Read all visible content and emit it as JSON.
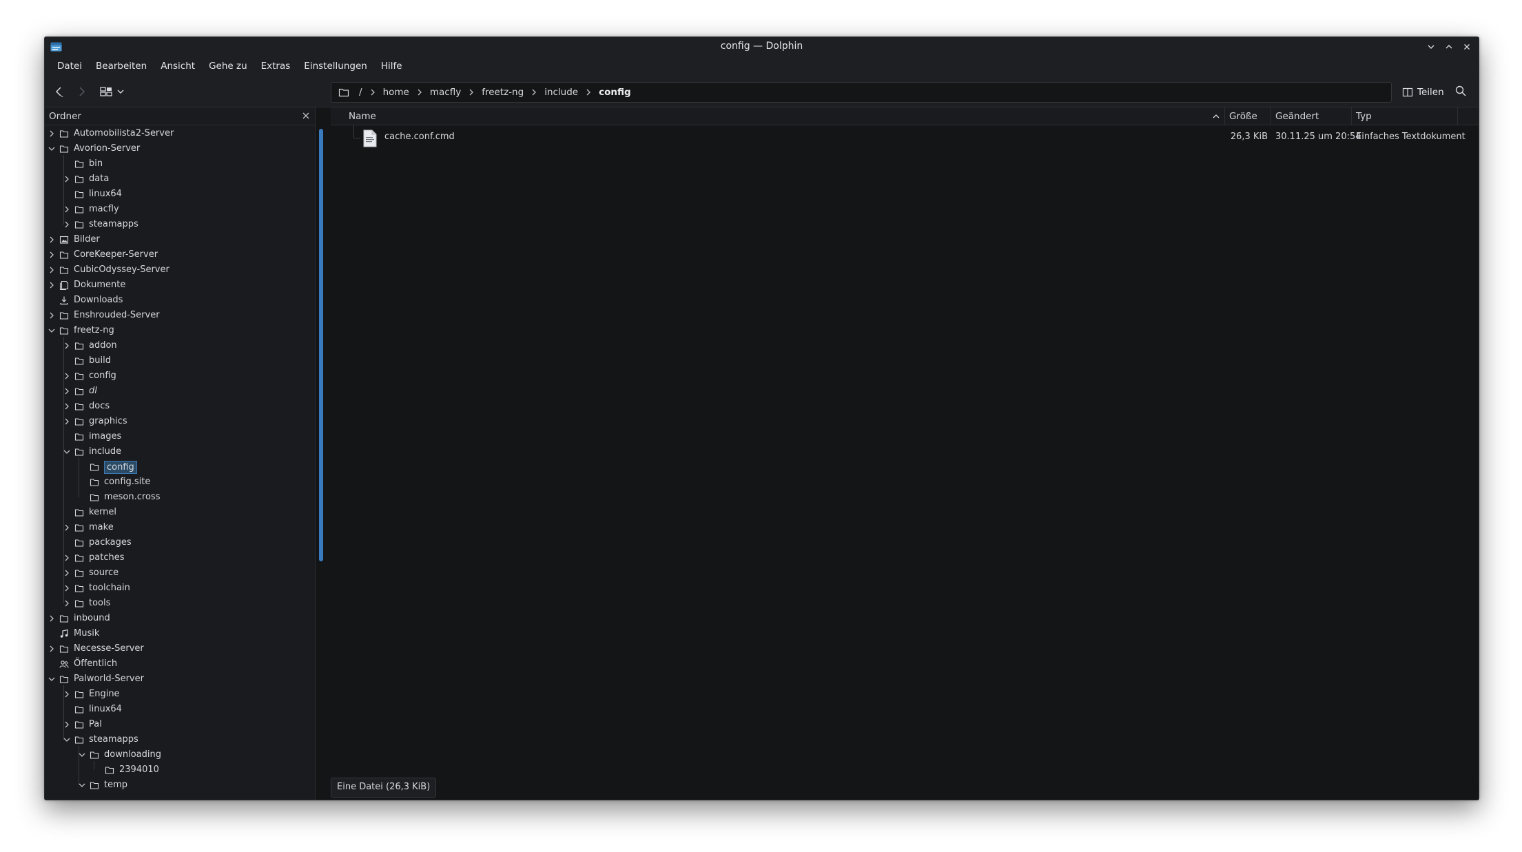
{
  "window": {
    "title": "config — Dolphin"
  },
  "menubar": {
    "items": [
      "Datei",
      "Bearbeiten",
      "Ansicht",
      "Gehe zu",
      "Extras",
      "Einstellungen",
      "Hilfe"
    ]
  },
  "toolbar": {
    "breadcrumbs": [
      "/",
      "home",
      "macfly",
      "freetz-ng",
      "include",
      "config"
    ],
    "share_label": "Teilen"
  },
  "folders_panel": {
    "title": "Ordner",
    "items": [
      {
        "label": "Automobilista2-Server",
        "depth": 0,
        "arrow": "right",
        "icon": "folder-icon"
      },
      {
        "label": "Avorion-Server",
        "depth": 0,
        "arrow": "down",
        "icon": "folder-icon"
      },
      {
        "label": "bin",
        "depth": 1,
        "arrow": "none",
        "icon": "folder-icon"
      },
      {
        "label": "data",
        "depth": 1,
        "arrow": "right",
        "icon": "folder-icon"
      },
      {
        "label": "linux64",
        "depth": 1,
        "arrow": "none",
        "icon": "folder-icon"
      },
      {
        "label": "macfly",
        "depth": 1,
        "arrow": "right",
        "icon": "folder-icon"
      },
      {
        "label": "steamapps",
        "depth": 1,
        "arrow": "right",
        "icon": "folder-icon"
      },
      {
        "label": "Bilder",
        "depth": 0,
        "arrow": "right",
        "icon": "image-folder-icon"
      },
      {
        "label": "CoreKeeper-Server",
        "depth": 0,
        "arrow": "right",
        "icon": "folder-icon"
      },
      {
        "label": "CubicOdyssey-Server",
        "depth": 0,
        "arrow": "right",
        "icon": "folder-icon"
      },
      {
        "label": "Dokumente",
        "depth": 0,
        "arrow": "right",
        "icon": "documents-folder-icon"
      },
      {
        "label": "Downloads",
        "depth": 0,
        "arrow": "none",
        "icon": "download-icon"
      },
      {
        "label": "Enshrouded-Server",
        "depth": 0,
        "arrow": "right",
        "icon": "folder-icon"
      },
      {
        "label": "freetz-ng",
        "depth": 0,
        "arrow": "down",
        "icon": "folder-icon"
      },
      {
        "label": "addon",
        "depth": 1,
        "arrow": "right",
        "icon": "folder-icon"
      },
      {
        "label": "build",
        "depth": 1,
        "arrow": "none",
        "icon": "folder-icon"
      },
      {
        "label": "config",
        "depth": 1,
        "arrow": "right",
        "icon": "folder-icon"
      },
      {
        "label": "dl",
        "depth": 1,
        "arrow": "right",
        "icon": "folder-icon",
        "italic": true
      },
      {
        "label": "docs",
        "depth": 1,
        "arrow": "right",
        "icon": "folder-icon"
      },
      {
        "label": "graphics",
        "depth": 1,
        "arrow": "right",
        "icon": "folder-icon"
      },
      {
        "label": "images",
        "depth": 1,
        "arrow": "none",
        "icon": "folder-icon"
      },
      {
        "label": "include",
        "depth": 1,
        "arrow": "down",
        "icon": "folder-icon"
      },
      {
        "label": "config",
        "depth": 2,
        "arrow": "none",
        "icon": "folder-icon",
        "selected": true
      },
      {
        "label": "config.site",
        "depth": 2,
        "arrow": "none",
        "icon": "folder-icon"
      },
      {
        "label": "meson.cross",
        "depth": 2,
        "arrow": "none",
        "icon": "folder-icon"
      },
      {
        "label": "kernel",
        "depth": 1,
        "arrow": "none",
        "icon": "folder-icon"
      },
      {
        "label": "make",
        "depth": 1,
        "arrow": "right",
        "icon": "folder-icon"
      },
      {
        "label": "packages",
        "depth": 1,
        "arrow": "none",
        "icon": "folder-icon"
      },
      {
        "label": "patches",
        "depth": 1,
        "arrow": "right",
        "icon": "folder-icon"
      },
      {
        "label": "source",
        "depth": 1,
        "arrow": "right",
        "icon": "folder-icon"
      },
      {
        "label": "toolchain",
        "depth": 1,
        "arrow": "right",
        "icon": "folder-icon"
      },
      {
        "label": "tools",
        "depth": 1,
        "arrow": "right",
        "icon": "folder-icon"
      },
      {
        "label": "inbound",
        "depth": 0,
        "arrow": "right",
        "icon": "folder-icon"
      },
      {
        "label": "Musik",
        "depth": 0,
        "arrow": "none",
        "icon": "music-icon"
      },
      {
        "label": "Necesse-Server",
        "depth": 0,
        "arrow": "right",
        "icon": "folder-icon"
      },
      {
        "label": "Öffentlich",
        "depth": 0,
        "arrow": "none",
        "icon": "public-users-icon"
      },
      {
        "label": "Palworld-Server",
        "depth": 0,
        "arrow": "down",
        "icon": "folder-icon"
      },
      {
        "label": "Engine",
        "depth": 1,
        "arrow": "right",
        "icon": "folder-icon"
      },
      {
        "label": "linux64",
        "depth": 1,
        "arrow": "none",
        "icon": "folder-icon"
      },
      {
        "label": "Pal",
        "depth": 1,
        "arrow": "right",
        "icon": "folder-icon"
      },
      {
        "label": "steamapps",
        "depth": 1,
        "arrow": "down",
        "icon": "folder-icon"
      },
      {
        "label": "downloading",
        "depth": 2,
        "arrow": "down",
        "icon": "folder-icon"
      },
      {
        "label": "2394010",
        "depth": 3,
        "arrow": "none",
        "icon": "folder-icon"
      },
      {
        "label": "temp",
        "depth": 2,
        "arrow": "down",
        "icon": "folder-icon"
      }
    ]
  },
  "file_view": {
    "columns": {
      "name": "Name",
      "size": "Größe",
      "modified": "Geändert",
      "type": "Typ"
    },
    "files": [
      {
        "name": "cache.conf.cmd",
        "size": "26,3 KiB",
        "modified": "30.11.25 um 20:54",
        "type": "Einfaches Textdokument",
        "icon": "text-file-icon"
      }
    ]
  },
  "statusbar": {
    "text": "Eine Datei (26,3 KiB)"
  },
  "colors": {
    "background": "#141517",
    "panel": "#1a1b1e",
    "bar": "#1e1f23",
    "accent": "#3a7bbf",
    "selection": "#2a4a66"
  }
}
